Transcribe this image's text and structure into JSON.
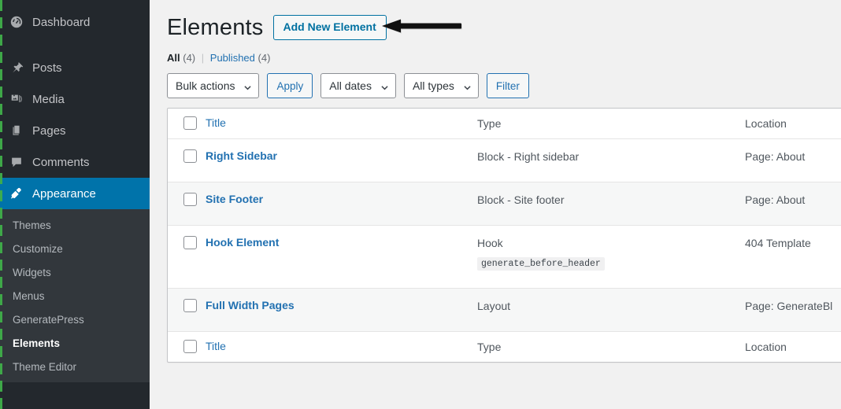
{
  "sidebar": {
    "items": [
      {
        "label": "Dashboard",
        "icon": "dashboard-icon",
        "current": false
      },
      {
        "label": "Posts",
        "icon": "pin-icon",
        "current": false
      },
      {
        "label": "Media",
        "icon": "media-icon",
        "current": false
      },
      {
        "label": "Pages",
        "icon": "pages-icon",
        "current": false
      },
      {
        "label": "Comments",
        "icon": "comments-icon",
        "current": false
      },
      {
        "label": "Appearance",
        "icon": "brush-icon",
        "current": true
      }
    ],
    "submenu": [
      {
        "label": "Themes",
        "current": false
      },
      {
        "label": "Customize",
        "current": false
      },
      {
        "label": "Widgets",
        "current": false
      },
      {
        "label": "Menus",
        "current": false
      },
      {
        "label": "GeneratePress",
        "current": false
      },
      {
        "label": "Elements",
        "current": true
      },
      {
        "label": "Theme Editor",
        "current": false
      }
    ],
    "accent_current": "#0073aa",
    "background": "#23282d",
    "submenu_background": "#32373c"
  },
  "header": {
    "title": "Elements",
    "add_new_label": "Add New Element"
  },
  "annotation": {
    "type": "arrow",
    "direction": "left",
    "color": "#111111",
    "points_to": "Add New Element"
  },
  "views": {
    "all_label": "All",
    "all_count": "(4)",
    "separator": "|",
    "published_label": "Published",
    "published_count": "(4)"
  },
  "toolbar": {
    "bulk_actions_label": "Bulk actions",
    "apply_label": "Apply",
    "all_dates_label": "All dates",
    "all_types_label": "All types",
    "filter_label": "Filter"
  },
  "table": {
    "columns": {
      "title": "Title",
      "type": "Type",
      "location": "Location"
    },
    "rows": [
      {
        "title": "Right Sidebar",
        "type": "Block - Right sidebar",
        "code": "",
        "location": "Page: About"
      },
      {
        "title": "Site Footer",
        "type": "Block - Site footer",
        "code": "",
        "location": "Page: About"
      },
      {
        "title": "Hook Element",
        "type": "Hook",
        "code": "generate_before_header",
        "location": "404 Template"
      },
      {
        "title": "Full Width Pages",
        "type": "Layout",
        "code": "",
        "location": "Page: GenerateBl"
      }
    ]
  }
}
